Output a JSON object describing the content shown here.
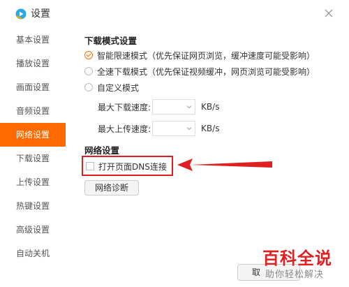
{
  "window": {
    "title": "设置"
  },
  "sidebar": {
    "items": [
      {
        "label": "基本设置"
      },
      {
        "label": "播放设置"
      },
      {
        "label": "画面设置"
      },
      {
        "label": "音频设置"
      },
      {
        "label": "网络设置",
        "active": true
      },
      {
        "label": "下载设置"
      },
      {
        "label": "上传设置"
      },
      {
        "label": "热键设置"
      },
      {
        "label": "高级设置"
      },
      {
        "label": "自动关机"
      }
    ]
  },
  "download": {
    "section_title": "下载模式设置",
    "modes": [
      {
        "label": "智能限速模式（优先保证网页浏览，缓冲速度可能受影响）",
        "checked": true
      },
      {
        "label": "全速下载模式（优先保证视频缓冲，网页浏览可能受影响）",
        "checked": false
      },
      {
        "label": "自定义模式",
        "checked": false
      }
    ],
    "max_download_label": "最大下载速度:",
    "max_upload_label": "最大上传速度:",
    "unit": "KB/s"
  },
  "network": {
    "section_title": "网络设置",
    "dns_checkbox_label": "打开页面DNS连接",
    "dns_checked": false,
    "diag_button": "网络诊断"
  },
  "footer": {
    "partial_button": "取"
  },
  "watermark": {
    "main": "百科全说",
    "sub": "助你轻松解决"
  },
  "colors": {
    "accent": "#ff6a00",
    "annotation_red": "#e02020"
  }
}
